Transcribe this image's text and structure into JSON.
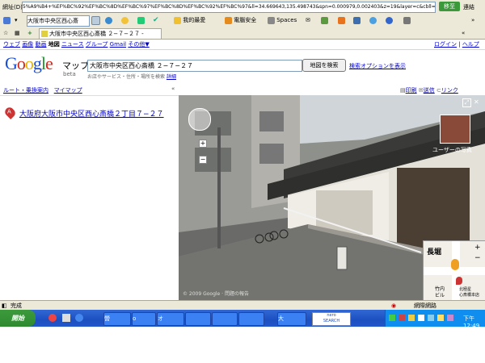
{
  "addressbar": {
    "label": "網址(D)",
    "url": "5%A9%B4+%EF%BC%92%EF%BC%8D%EF%BC%97%EF%BC%8D%EF%BC%92%EF%BC%97&ll=34.669643,135.498743&spn=0.000979,0.002403&z=19&layer=c&cbll=",
    "go_label": "移至",
    "links_label": "連結"
  },
  "toolbar": {
    "search_value": "大阪市中央区西心斎",
    "favorites_label": "我的最愛",
    "security_label": "電腦安全",
    "spaces_label": "Spaces"
  },
  "tab": {
    "title": "大阪市中央区西心斎橋 ２−７−２７ -"
  },
  "google_nav": {
    "links": [
      "ウェブ",
      "画像",
      "動画"
    ],
    "current": "地図",
    "links2": [
      "ニュース",
      "グループ",
      "Gmail"
    ],
    "more": "その他▼",
    "login": "ログイン",
    "help": "ヘルプ"
  },
  "header": {
    "logo": "Google",
    "product": "マップ",
    "beta": "beta",
    "query": "大阪市中央区西心斎橋 ２−７−２７",
    "hint": "お店やサービス・住所・場所を検索",
    "hint_example": "詳細",
    "search_button": "地図を検索",
    "options_link": "検索オプションを表示"
  },
  "subbar": {
    "route": "ルート・乗換案内",
    "mymaps": "マイマップ",
    "collapse": "«",
    "print": "印刷",
    "send": "送信",
    "link": "リンク"
  },
  "result": {
    "marker": "A",
    "address": "大阪府大阪市中央区西心斎橋２丁目７−２７"
  },
  "streetview": {
    "user_photos": "ユーザーの写真",
    "copyright": "© 2009 Google · 問題の報告",
    "minimap_label1": "竹内",
    "minimap_label2": "ビル",
    "minimap_label3": "北極星",
    "minimap_label4": "心斎橋本店",
    "sign_text": "長堀",
    "zoom_in": "+",
    "zoom_out": "−"
  },
  "statusbar": {
    "text": "完成",
    "zone": "網際網路"
  },
  "taskbar": {
    "start": "開始",
    "tasks": [
      "營",
      "o",
      "オ",
      "",
      "",
      "",
      "大"
    ],
    "nero": "nero\nSEARCH",
    "clock": "下午 12:49"
  },
  "colors": {
    "link": "#0000cc",
    "xp_chrome": "#ece9d8",
    "taskbar": "#2356c9",
    "start": "#2f8a2f"
  }
}
